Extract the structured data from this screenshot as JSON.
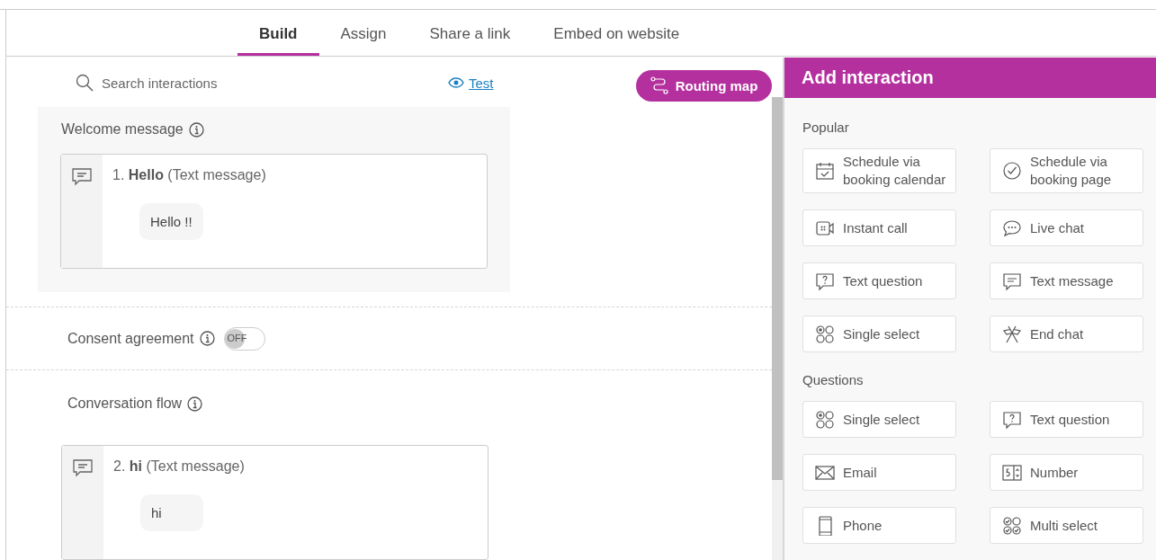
{
  "tabs": [
    {
      "label": "Build",
      "selected": true
    },
    {
      "label": "Assign",
      "selected": false
    },
    {
      "label": "Share a link",
      "selected": false
    },
    {
      "label": "Embed on website",
      "selected": false
    }
  ],
  "search": {
    "placeholder": "Search interactions"
  },
  "test_link": "Test",
  "routing_button": "Routing map",
  "welcome": {
    "title": "Welcome message",
    "card": {
      "title": "1. **Hello** (Text message)",
      "bubble": "Hello !!"
    }
  },
  "consent": {
    "label": "Consent agreement",
    "on": false,
    "toggle_text": "OFF"
  },
  "flow": {
    "title": "Conversation flow",
    "cards": [
      {
        "title": "2. **hi** (Text message)",
        "bubble": "hi"
      }
    ]
  },
  "panel": {
    "title": "Add interaction",
    "sections": [
      {
        "title": "Popular",
        "items": [
          {
            "label": "Schedule via booking calendar",
            "kind": "calendar"
          },
          {
            "label": "Schedule via booking page",
            "kind": "check"
          },
          {
            "label": "Instant call",
            "kind": "video"
          },
          {
            "label": "Live chat",
            "kind": "chat"
          },
          {
            "label": "Text question",
            "kind": "question"
          },
          {
            "label": "Text message",
            "kind": "message"
          },
          {
            "label": "Single select",
            "kind": "radio"
          },
          {
            "label": "End chat",
            "kind": "flags"
          }
        ]
      },
      {
        "title": "Questions",
        "items": [
          {
            "label": "Single select",
            "kind": "radio"
          },
          {
            "label": "Text question",
            "kind": "question"
          },
          {
            "label": "Email",
            "kind": "email"
          },
          {
            "label": "Number",
            "kind": "number"
          },
          {
            "label": "Phone",
            "kind": "phone"
          },
          {
            "label": "Multi select",
            "kind": "multi"
          }
        ]
      }
    ]
  }
}
